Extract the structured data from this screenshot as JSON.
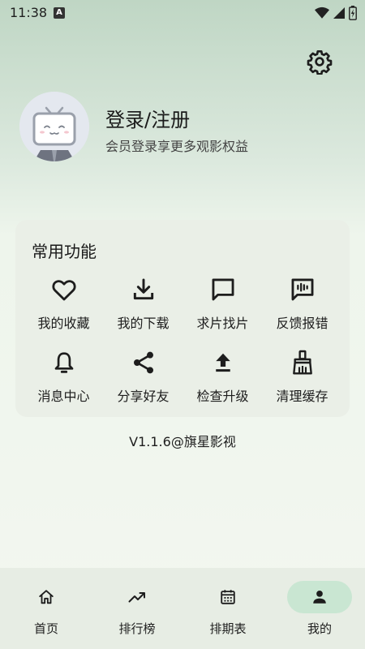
{
  "status": {
    "time": "11:38",
    "indicator": "A"
  },
  "header": {
    "settings_icon": "gear-icon"
  },
  "profile": {
    "title": "登录/注册",
    "subtitle": "会员登录享更多观影权益",
    "avatar_icon": "tv-mascot-avatar"
  },
  "functions": {
    "title": "常用功能",
    "items": [
      {
        "label": "我的收藏",
        "icon": "heart-icon"
      },
      {
        "label": "我的下载",
        "icon": "download-icon"
      },
      {
        "label": "求片找片",
        "icon": "chat-bubble-icon"
      },
      {
        "label": "反馈报错",
        "icon": "feedback-icon"
      },
      {
        "label": "消息中心",
        "icon": "bell-icon"
      },
      {
        "label": "分享好友",
        "icon": "share-icon"
      },
      {
        "label": "检查升级",
        "icon": "upload-icon"
      },
      {
        "label": "清理缓存",
        "icon": "broom-icon"
      }
    ]
  },
  "version": "V1.1.6@旗星影视",
  "nav": {
    "items": [
      {
        "label": "首页",
        "icon": "home-icon"
      },
      {
        "label": "排行榜",
        "icon": "trending-icon"
      },
      {
        "label": "排期表",
        "icon": "calendar-icon"
      },
      {
        "label": "我的",
        "icon": "person-icon",
        "active": true
      }
    ]
  },
  "colors": {
    "active_pill": "#c9e6d2",
    "card_bg": "#eaefe7",
    "nav_bg": "#e7ede4"
  }
}
